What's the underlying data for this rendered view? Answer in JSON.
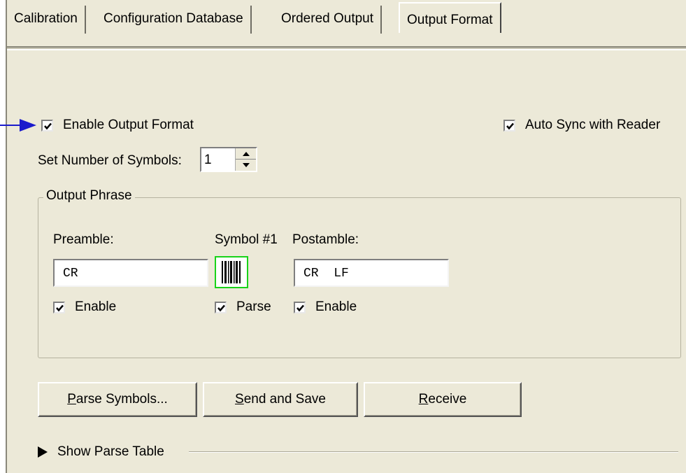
{
  "tabs": [
    {
      "label": "Calibration",
      "active": false
    },
    {
      "label": "Configuration Database",
      "active": false
    },
    {
      "label": "Ordered Output",
      "active": false
    },
    {
      "label": "Output Format",
      "active": true
    }
  ],
  "enable_output_format": {
    "label": "Enable Output Format",
    "checked": true
  },
  "auto_sync": {
    "label": "Auto Sync with Reader",
    "checked": true
  },
  "symbols": {
    "label": "Set Number of Symbols:",
    "value": "1"
  },
  "output_phrase": {
    "title": "Output Phrase",
    "preamble": {
      "label": "Preamble:",
      "value": "CR",
      "enable_label": "Enable",
      "checked": true
    },
    "symbol": {
      "label": "Symbol #1",
      "parse_label": "Parse",
      "checked": true,
      "icon": "barcode-icon"
    },
    "postamble": {
      "label": "Postamble:",
      "value": "CR  LF",
      "enable_label": "Enable",
      "checked": true
    }
  },
  "buttons": {
    "parse_symbols": {
      "mnemonic": "P",
      "rest": "arse Symbols..."
    },
    "send_save": {
      "mnemonic": "S",
      "rest": "end and Save"
    },
    "receive": {
      "mnemonic": "R",
      "rest": "eceive"
    }
  },
  "parse_table": {
    "label": "Show Parse Table",
    "icon": "expand-triangle-icon"
  },
  "colors": {
    "pointer": "#1a1acc",
    "symbol_border": "#19d319",
    "window_bg": "#ece9d8"
  }
}
